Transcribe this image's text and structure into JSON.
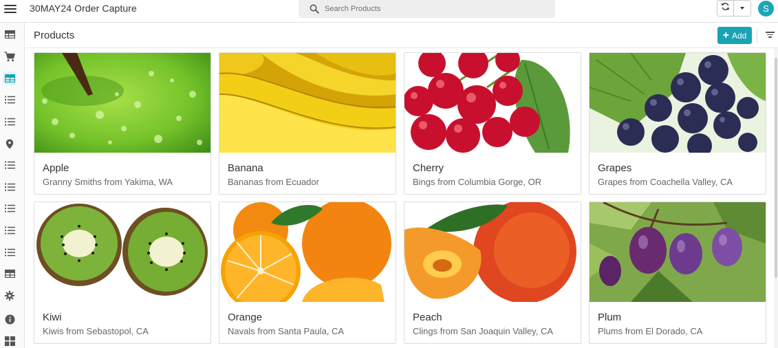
{
  "app": {
    "title": "30MAY24 Order Capture",
    "user_initial": "S"
  },
  "search": {
    "placeholder": "Search Products"
  },
  "page": {
    "title": "Products",
    "add_label": "Add"
  },
  "colors": {
    "accent": "#19a3b3",
    "avatar": "#1aa6b7"
  },
  "rail": {
    "items": [
      {
        "icon": "table-icon"
      },
      {
        "icon": "cart-icon"
      },
      {
        "icon": "grid-icon",
        "active": true
      },
      {
        "icon": "list-icon"
      },
      {
        "icon": "list-icon"
      },
      {
        "icon": "location-pin-icon"
      },
      {
        "icon": "list-icon"
      },
      {
        "icon": "list-icon"
      },
      {
        "icon": "list-icon"
      },
      {
        "icon": "list-icon"
      },
      {
        "icon": "list-icon"
      },
      {
        "icon": "table-icon"
      },
      {
        "icon": "gear-icon"
      },
      {
        "icon": "info-icon"
      },
      {
        "icon": "dashboard-icon"
      }
    ]
  },
  "products": [
    {
      "name": "Apple",
      "desc": "Granny Smiths from Yakima, WA",
      "image": "green-apple-image"
    },
    {
      "name": "Banana",
      "desc": "Bananas from Ecuador",
      "image": "banana-image"
    },
    {
      "name": "Cherry",
      "desc": "Bings from Columbia Gorge, OR",
      "image": "cherry-image"
    },
    {
      "name": "Grapes",
      "desc": "Grapes from Coachella Valley, CA",
      "image": "grapes-image"
    },
    {
      "name": "Kiwi",
      "desc": "Kiwis from Sebastopol, CA",
      "image": "kiwi-image"
    },
    {
      "name": "Orange",
      "desc": "Navals from Santa Paula, CA",
      "image": "orange-image"
    },
    {
      "name": "Peach",
      "desc": "Clings from San Joaquin Valley, CA",
      "image": "peach-image"
    },
    {
      "name": "Plum",
      "desc": "Plums from El Dorado, CA",
      "image": "plum-image"
    }
  ]
}
